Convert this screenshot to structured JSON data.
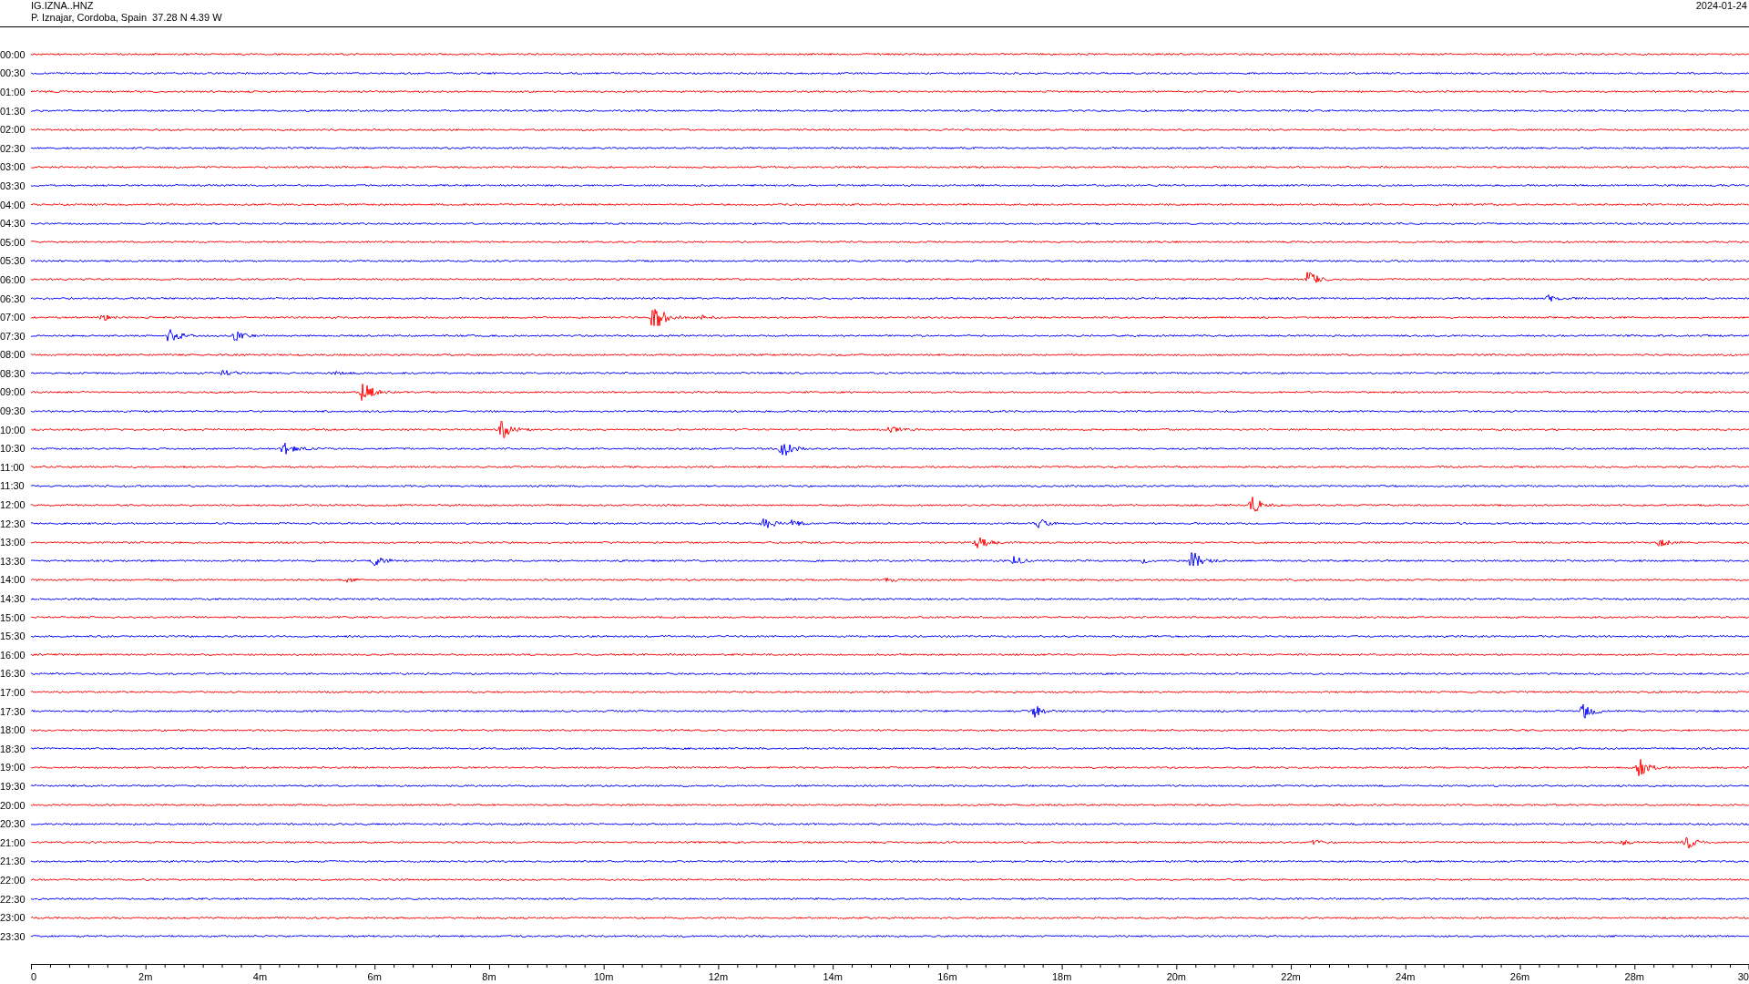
{
  "header": {
    "station": "IG.IZNA..HNZ",
    "location": "P. Iznajar, Cordoba, Spain  37.28 N 4.39 W",
    "date": "2024-01-24"
  },
  "rows": [
    {
      "time": "00:00",
      "color": "#ff0000"
    },
    {
      "time": "00:30",
      "color": "#0000ff"
    },
    {
      "time": "01:00",
      "color": "#ff0000"
    },
    {
      "time": "01:30",
      "color": "#0000ff"
    },
    {
      "time": "02:00",
      "color": "#ff0000"
    },
    {
      "time": "02:30",
      "color": "#0000ff"
    },
    {
      "time": "03:00",
      "color": "#ff0000"
    },
    {
      "time": "03:30",
      "color": "#0000ff"
    },
    {
      "time": "04:00",
      "color": "#ff0000"
    },
    {
      "time": "04:30",
      "color": "#0000ff"
    },
    {
      "time": "05:00",
      "color": "#ff0000"
    },
    {
      "time": "05:30",
      "color": "#0000ff"
    },
    {
      "time": "06:00",
      "color": "#ff0000"
    },
    {
      "time": "06:30",
      "color": "#0000ff"
    },
    {
      "time": "07:00",
      "color": "#ff0000"
    },
    {
      "time": "07:30",
      "color": "#0000ff"
    },
    {
      "time": "08:00",
      "color": "#ff0000"
    },
    {
      "time": "08:30",
      "color": "#0000ff"
    },
    {
      "time": "09:00",
      "color": "#ff0000"
    },
    {
      "time": "09:30",
      "color": "#0000ff"
    },
    {
      "time": "10:00",
      "color": "#ff0000"
    },
    {
      "time": "10:30",
      "color": "#0000ff"
    },
    {
      "time": "11:00",
      "color": "#ff0000"
    },
    {
      "time": "11:30",
      "color": "#0000ff"
    },
    {
      "time": "12:00",
      "color": "#ff0000"
    },
    {
      "time": "12:30",
      "color": "#0000ff"
    },
    {
      "time": "13:00",
      "color": "#ff0000"
    },
    {
      "time": "13:30",
      "color": "#0000ff"
    },
    {
      "time": "14:00",
      "color": "#ff0000"
    },
    {
      "time": "14:30",
      "color": "#0000ff"
    },
    {
      "time": "15:00",
      "color": "#ff0000"
    },
    {
      "time": "15:30",
      "color": "#0000ff"
    },
    {
      "time": "16:00",
      "color": "#ff0000"
    },
    {
      "time": "16:30",
      "color": "#0000ff"
    },
    {
      "time": "17:00",
      "color": "#ff0000"
    },
    {
      "time": "17:30",
      "color": "#0000ff"
    },
    {
      "time": "18:00",
      "color": "#ff0000"
    },
    {
      "time": "18:30",
      "color": "#0000ff"
    },
    {
      "time": "19:00",
      "color": "#ff0000"
    },
    {
      "time": "19:30",
      "color": "#0000ff"
    },
    {
      "time": "20:00",
      "color": "#ff0000"
    },
    {
      "time": "20:30",
      "color": "#0000ff"
    },
    {
      "time": "21:00",
      "color": "#ff0000"
    },
    {
      "time": "21:30",
      "color": "#0000ff"
    },
    {
      "time": "22:00",
      "color": "#ff0000"
    },
    {
      "time": "22:30",
      "color": "#0000ff"
    },
    {
      "time": "23:00",
      "color": "#ff0000"
    },
    {
      "time": "23:30",
      "color": "#0000ff"
    }
  ],
  "axis": {
    "labels": [
      "0",
      "2m",
      "4m",
      "6m",
      "8m",
      "10m",
      "12m",
      "14m",
      "16m",
      "18m",
      "20m",
      "22m",
      "24m",
      "26m",
      "28m",
      "30"
    ]
  }
}
